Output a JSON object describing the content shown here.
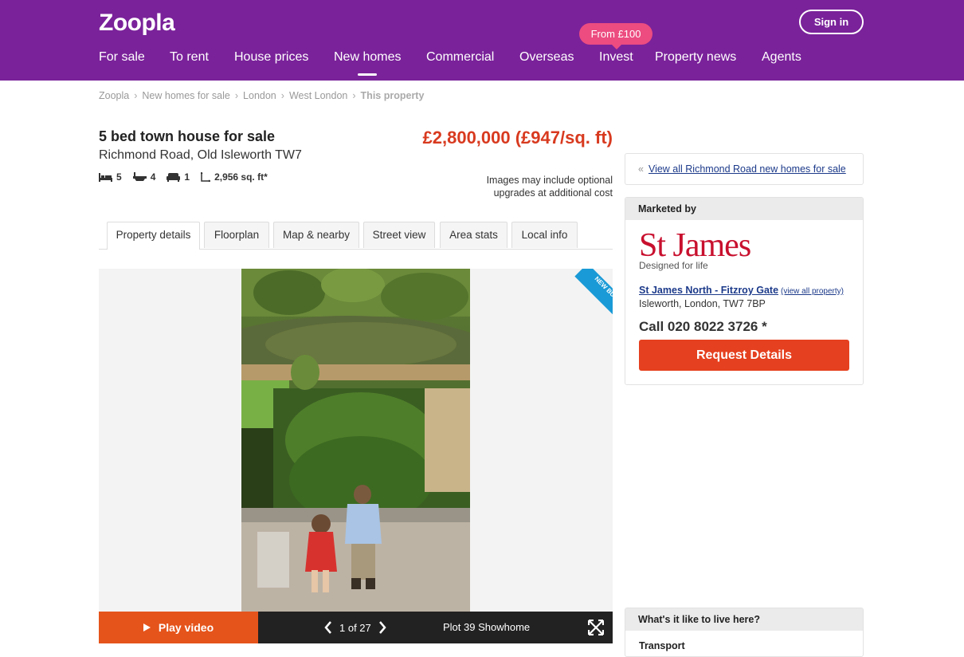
{
  "header": {
    "logo": "Zoopla",
    "signin_label": "Sign in",
    "nav": [
      "For sale",
      "To rent",
      "House prices",
      "New homes",
      "Commercial",
      "Overseas",
      "Invest",
      "Property news",
      "Agents"
    ],
    "invest_badge": "From £100",
    "active_nav": "New homes",
    "brand_color": "#7a229a"
  },
  "breadcrumb": {
    "items": [
      "Zoopla",
      "New homes for sale",
      "London",
      "West London"
    ],
    "current": "This property"
  },
  "listing": {
    "title": "5 bed town house for sale",
    "address": "Richmond Road, Old Isleworth TW7",
    "price": "£2,800,000 (£947/sq. ft)",
    "beds": "5",
    "baths": "4",
    "receptions": "1",
    "area": "2,956 sq. ft*",
    "images_note_line1": "Images may include optional",
    "images_note_line2": "upgrades at additional cost",
    "price_color": "#d83a1f"
  },
  "tabs": [
    "Property details",
    "Floorplan",
    "Map & nearby",
    "Street view",
    "Area stats",
    "Local info"
  ],
  "gallery": {
    "ribbon": "NEW BUILD",
    "play_label": "Play video",
    "counter": "1 of 27",
    "caption": "Plot 39 Showhome"
  },
  "sidebar": {
    "back_link": "View all Richmond Road new homes for sale",
    "marketed_by": "Marketed by",
    "agent_logo": "St James",
    "agent_tagline": "Designed for life",
    "agent_name": "St James North - Fitzroy Gate",
    "agent_view_all": "(view all property)",
    "agent_address": "Isleworth, London, TW7 7BP",
    "agent_phone": "Call 020 8022 3726 *",
    "request_label": "Request Details",
    "live_heading": "What's it like to live here?",
    "live_item": "Transport"
  }
}
